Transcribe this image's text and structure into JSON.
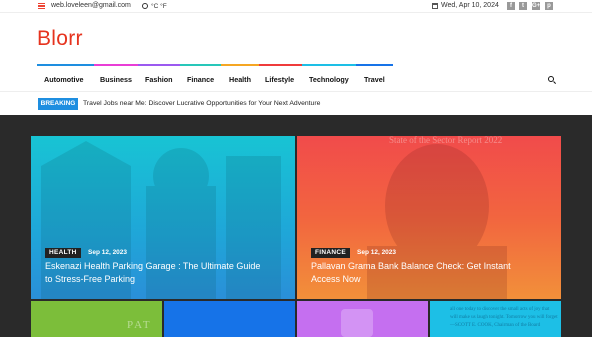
{
  "topbar": {
    "email": "web.loveleen@gmail.com",
    "units": "°C  °F",
    "date": "Wed, Apr 10, 2024",
    "social": [
      "f",
      "t",
      "G+",
      "p"
    ]
  },
  "site": {
    "logo": "Blorr"
  },
  "nav": {
    "items": [
      "Automotive",
      "Business",
      "Fashion",
      "Finance",
      "Health",
      "Lifestyle",
      "Technology",
      "Travel"
    ],
    "colors": [
      "#1e8ee0",
      "#e93dd6",
      "#9b59f0",
      "#28c7b9",
      "#f5a623",
      "#ef3b3b",
      "#1dbfe6",
      "#1673e8"
    ]
  },
  "breaking": {
    "label": "BREAKING",
    "headline": "Travel Jobs near Me: Discover Lucrative Opportunities for Your Next Adventure"
  },
  "featured": [
    {
      "category": "HEALTH",
      "date": "Sep 12, 2023",
      "title_line1": "Eskenazi Health Parking Garage : The Ultimate Guide",
      "title_line2": "to Stress-Free Parking",
      "color": "#18c4d4"
    },
    {
      "category": "FINANCE",
      "date": "Sep 12, 2023",
      "title_line1": "Pallavan Grama Bank Balance Check: Get Instant",
      "title_line2": "Access Now",
      "color": "#f14b4b",
      "overlay_text": "State of the Sector Report 2022"
    }
  ],
  "small_cards": {
    "c1_text": "PAT",
    "c4_text_1": "all one today to discover the small acts of joy that",
    "c4_text_2": "will make us laugh tonight. Tomorrow you will forget",
    "c4_text_3": "—SCOTT E. COOK, Chairman of the Board"
  }
}
